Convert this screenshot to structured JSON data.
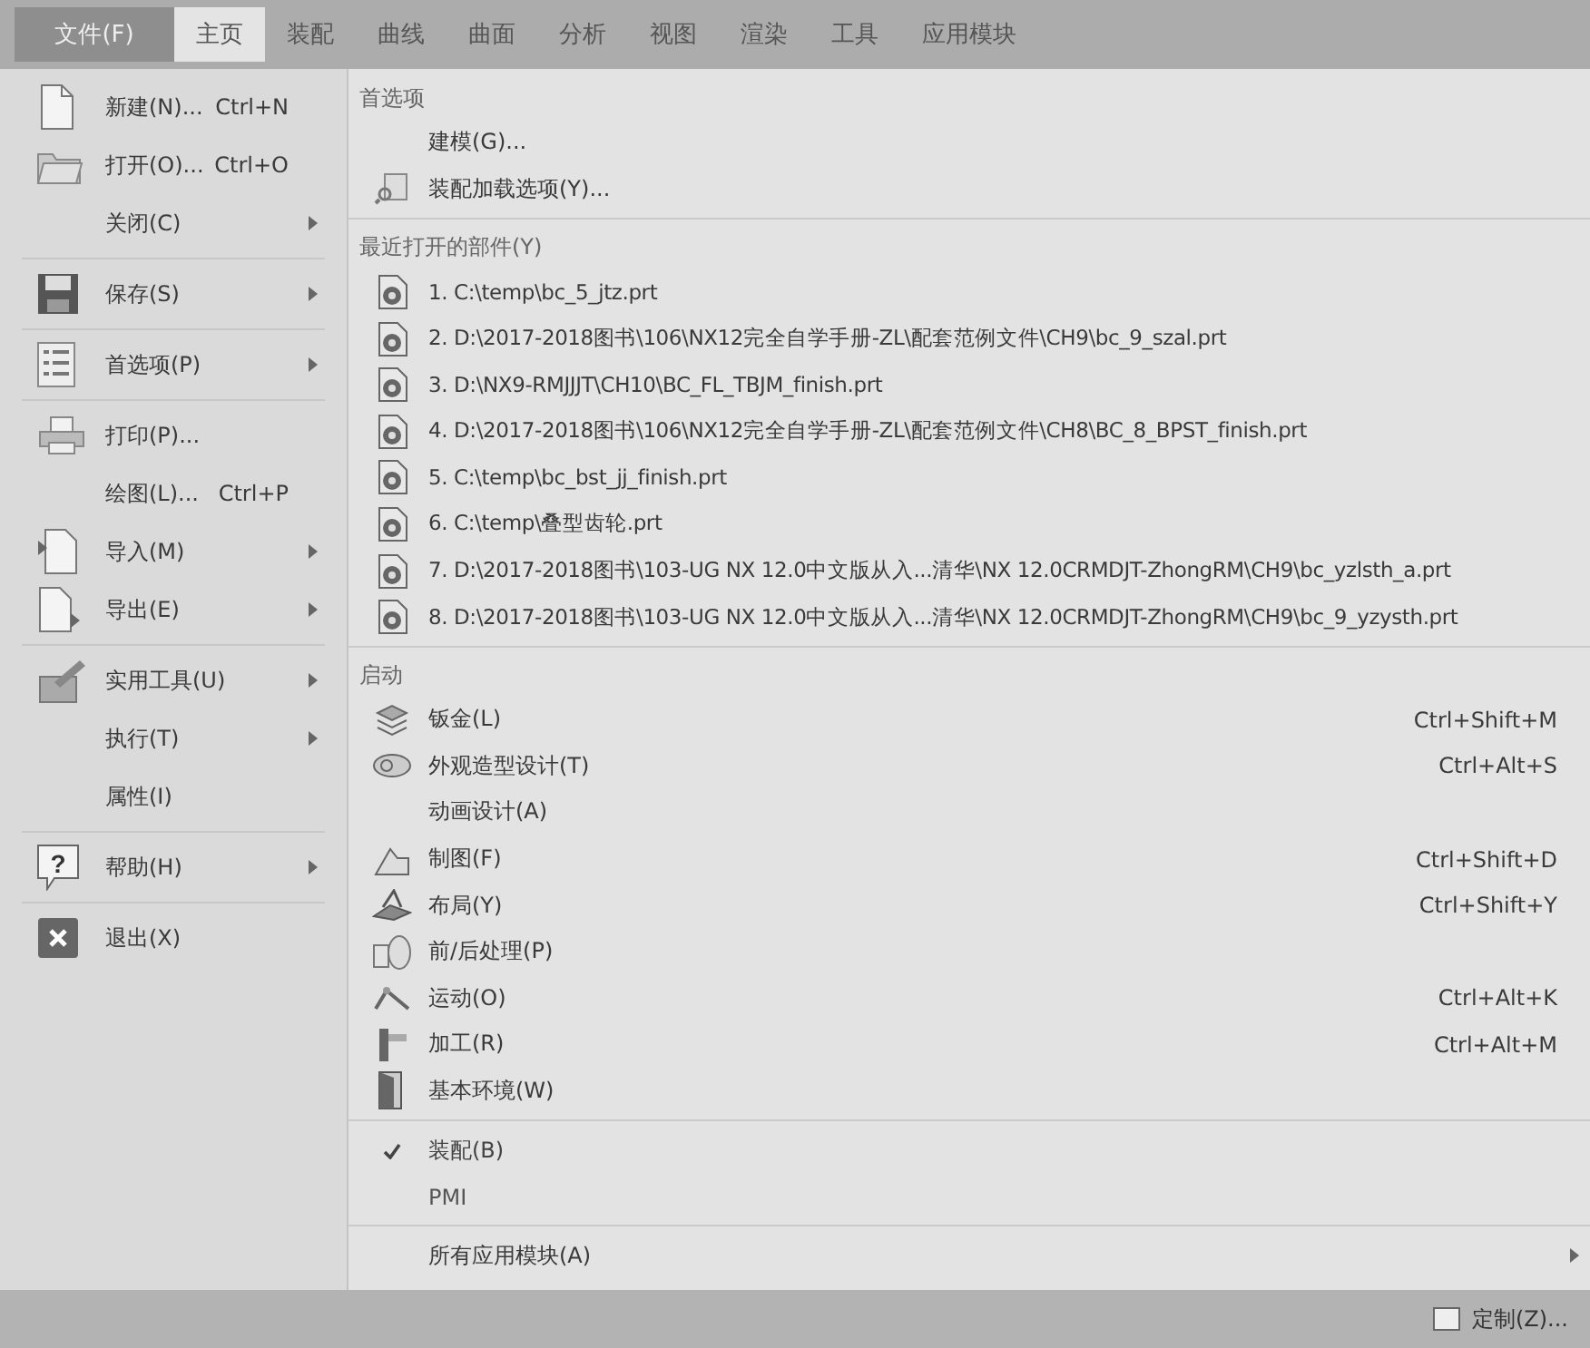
{
  "file_button": "文件(F)",
  "tabs": [
    {
      "label": "主页",
      "selected": true
    },
    {
      "label": "装配",
      "selected": false
    },
    {
      "label": "曲线",
      "selected": false
    },
    {
      "label": "曲面",
      "selected": false
    },
    {
      "label": "分析",
      "selected": false
    },
    {
      "label": "视图",
      "selected": false
    },
    {
      "label": "渲染",
      "selected": false
    },
    {
      "label": "工具",
      "selected": false
    },
    {
      "label": "应用模块",
      "selected": false
    }
  ],
  "left_menu": [
    {
      "items": [
        {
          "label": "新建(N)...",
          "shortcut": "Ctrl+N",
          "submenu": false
        },
        {
          "label": "打开(O)...",
          "shortcut": "Ctrl+O",
          "submenu": false
        },
        {
          "label": "关闭(C)",
          "submenu": true
        }
      ]
    },
    {
      "items": [
        {
          "label": "保存(S)",
          "submenu": true
        }
      ]
    },
    {
      "items": [
        {
          "label": "首选项(P)",
          "submenu": true
        }
      ]
    },
    {
      "items": [
        {
          "label": "打印(P)...",
          "submenu": false
        },
        {
          "label": "绘图(L)...",
          "shortcut": "Ctrl+P",
          "submenu": false
        },
        {
          "label": "导入(M)",
          "submenu": true
        },
        {
          "label": "导出(E)",
          "submenu": true
        }
      ]
    },
    {
      "items": [
        {
          "label": "实用工具(U)",
          "submenu": true
        },
        {
          "label": "执行(T)",
          "submenu": true
        },
        {
          "label": "属性(I)",
          "submenu": false
        }
      ]
    },
    {
      "items": [
        {
          "label": "帮助(H)",
          "submenu": true,
          "icon_text": "?"
        }
      ]
    },
    {
      "items": [
        {
          "label": "退出(X)",
          "submenu": false
        }
      ]
    }
  ],
  "preferences": {
    "heading": "首选项",
    "items": [
      "建模(G)...",
      "装配加载选项(Y)..."
    ]
  },
  "recent_parts": {
    "heading": "最近打开的部件(Y)",
    "items": [
      "1. C:\\temp\\bc_5_jtz.prt",
      "2. D:\\2017-2018图书\\106\\NX12完全自学手册-ZL\\配套范例文件\\CH9\\bc_9_szal.prt",
      "3. D:\\NX9-RMJJJT\\CH10\\BC_FL_TBJM_finish.prt",
      "4. D:\\2017-2018图书\\106\\NX12完全自学手册-ZL\\配套范例文件\\CH8\\BC_8_BPST_finish.prt",
      "5. C:\\temp\\bc_bst_jj_finish.prt",
      "6. C:\\temp\\叠型齿轮.prt",
      "7. D:\\2017-2018图书\\103-UG NX 12.0中文版从入...清华\\NX 12.0CRMDJT-ZhongRM\\CH9\\bc_yzlsth_a.prt",
      "8. D:\\2017-2018图书\\103-UG NX 12.0中文版从入...清华\\NX 12.0CRMDJT-ZhongRM\\CH9\\bc_9_yzysth.prt"
    ]
  },
  "launch": {
    "heading": "启动",
    "items": [
      {
        "label": "钣金(L)",
        "shortcut": "Ctrl+Shift+M"
      },
      {
        "label": "外观造型设计(T)",
        "shortcut": "Ctrl+Alt+S"
      },
      {
        "label": "动画设计(A)"
      },
      {
        "label": "制图(F)",
        "shortcut": "Ctrl+Shift+D"
      },
      {
        "label": "布局(Y)",
        "shortcut": "Ctrl+Shift+Y"
      },
      {
        "label": "前/后处理(P)"
      },
      {
        "label": "运动(O)",
        "shortcut": "Ctrl+Alt+K"
      },
      {
        "label": "加工(R)",
        "shortcut": "Ctrl+Alt+M"
      },
      {
        "label": "基本环境(W)"
      }
    ]
  },
  "toggles": [
    {
      "label": "装配(B)",
      "checked": true
    },
    {
      "label": "PMI",
      "checked": false
    }
  ],
  "all_modules": {
    "label": "所有应用模块(A)",
    "submenu": true
  },
  "status_bar": {
    "customize": "定制(Z)..."
  }
}
